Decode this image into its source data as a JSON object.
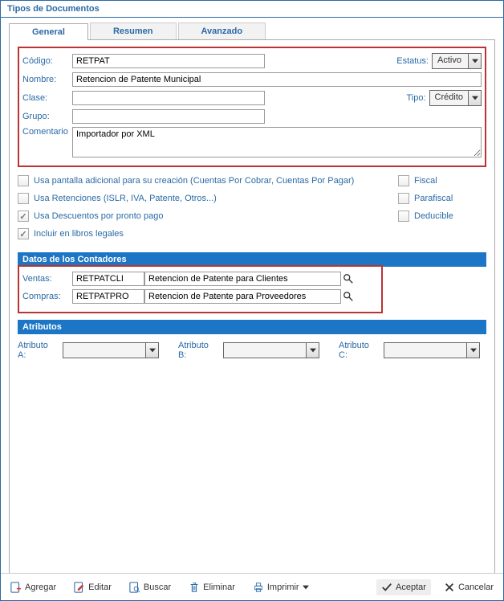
{
  "panel_title": "Tipos de Documentos",
  "tabs": {
    "general": "General",
    "resumen": "Resumen",
    "avanzado": "Avanzado"
  },
  "fields": {
    "codigo_label": "Código:",
    "codigo": "RETPAT",
    "estatus_label": "Estatus:",
    "estatus": "Activo",
    "nombre_label": "Nombre:",
    "nombre": "Retencion de Patente Municipal",
    "clase_label": "Clase:",
    "clase": "",
    "tipo_label": "Tipo:",
    "tipo": "Crédito",
    "grupo_label": "Grupo:",
    "grupo": "",
    "comentario_label": "Comentario",
    "comentario": "Importador por XML"
  },
  "checks": {
    "c1": "Usa pantalla adicional para su creación (Cuentas Por Cobrar, Cuentas Por Pagar)",
    "c2": "Usa Retenciones (ISLR, IVA, Patente, Otros...)",
    "c3": "Usa Descuentos por pronto pago",
    "c4": "Incluir en libros legales",
    "r1": "Fiscal",
    "r2": "Parafiscal",
    "r3": "Deducible"
  },
  "section_contadores": "Datos de los Contadores",
  "contadores": {
    "ventas_label": "Ventas:",
    "ventas_code": "RETPATCLI",
    "ventas_desc": "Retencion de Patente para Clientes",
    "compras_label": "Compras:",
    "compras_code": "RETPATPRO",
    "compras_desc": "Retencion de Patente para Proveedores"
  },
  "section_atributos": "Atributos",
  "attrs": {
    "a": "Atributo A:",
    "b": "Atributo B:",
    "c": "Atributo C:"
  },
  "toolbar": {
    "agregar": "Agregar",
    "editar": "Editar",
    "buscar": "Buscar",
    "eliminar": "Eliminar",
    "imprimir": "Imprimir",
    "aceptar": "Aceptar",
    "cancelar": "Cancelar"
  }
}
